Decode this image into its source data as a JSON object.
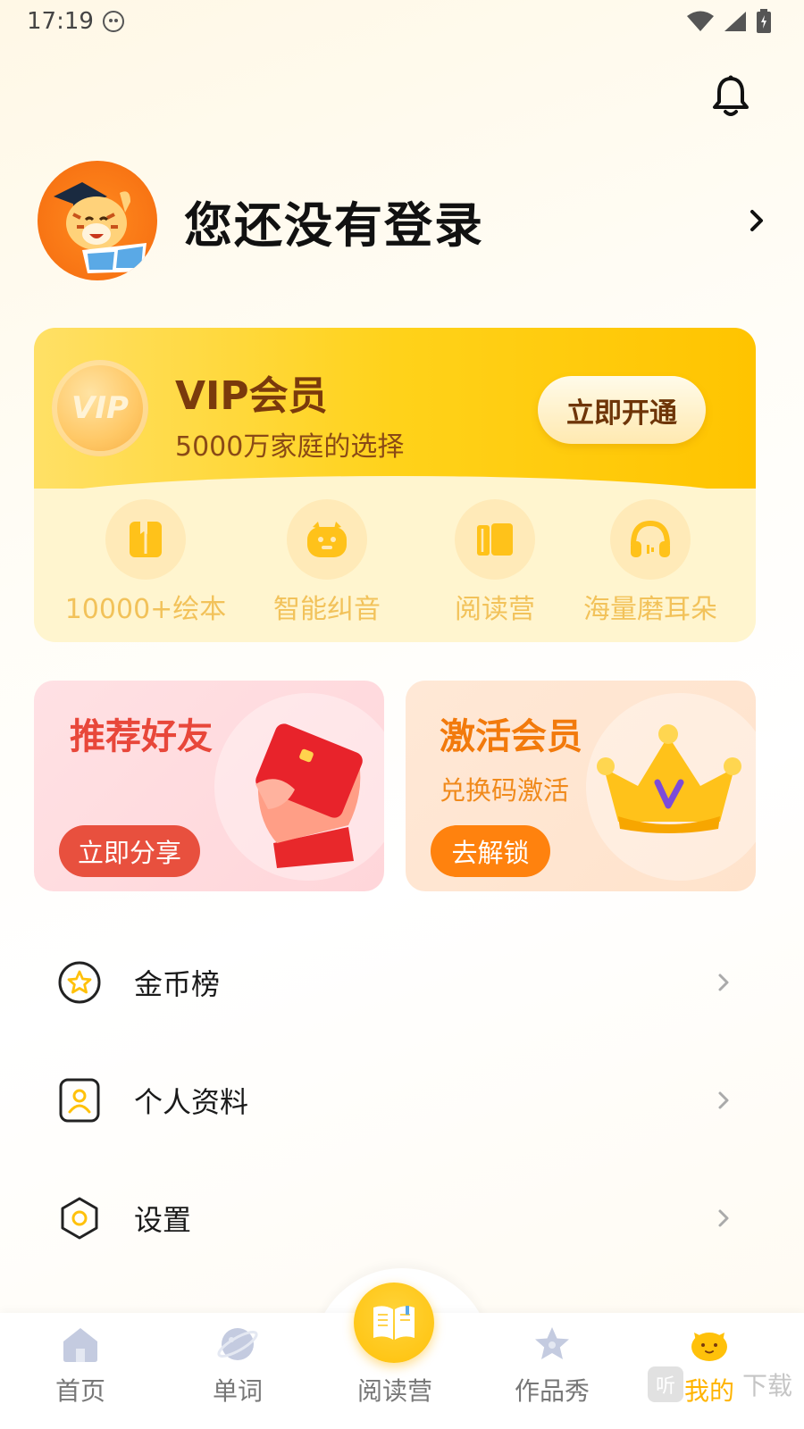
{
  "status_bar": {
    "time": "17:19"
  },
  "profile": {
    "login_text": "您还没有登录"
  },
  "vip": {
    "coin_text": "VIP",
    "title": "VIP会员",
    "subtitle": "5000万家庭的选择",
    "button": "立即开通",
    "features": [
      {
        "label": "10000+绘本",
        "icon": "book-icon"
      },
      {
        "label": "智能纠音",
        "icon": "robot-icon"
      },
      {
        "label": "阅读营",
        "icon": "books-icon"
      },
      {
        "label": "海量磨耳朵",
        "icon": "headphones-icon"
      }
    ]
  },
  "promo": {
    "refer": {
      "title": "推荐好友",
      "button": "立即分享"
    },
    "activate": {
      "title": "激活会员",
      "subtitle": "兑换码激活",
      "button": "去解锁"
    }
  },
  "menu": [
    {
      "label": "金币榜",
      "icon": "star-badge-icon"
    },
    {
      "label": "个人资料",
      "icon": "profile-card-icon"
    },
    {
      "label": "设置",
      "icon": "settings-hexagon-icon"
    }
  ],
  "tabbar": {
    "tabs": [
      {
        "label": "首页",
        "icon": "home-icon"
      },
      {
        "label": "单词",
        "icon": "planet-icon"
      },
      {
        "label": "阅读营",
        "icon": "open-book-icon"
      },
      {
        "label": "作品秀",
        "icon": "star-icon"
      },
      {
        "label": "我的",
        "icon": "tiger-face-icon"
      }
    ],
    "active_index": 4
  },
  "watermark": {
    "glyph": "听",
    "text": "下载"
  },
  "colors": {
    "accent": "#ffc10a",
    "vip_brown": "#7a3a0c",
    "refer_red": "#e8503e",
    "activate_orange": "#ff820e"
  }
}
